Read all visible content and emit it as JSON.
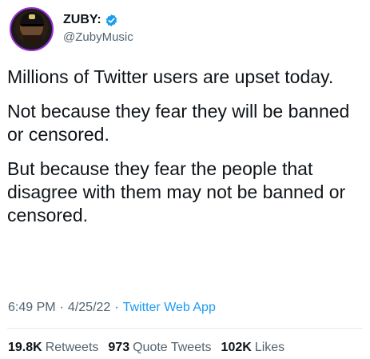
{
  "author": {
    "display_name": "ZUBY:",
    "handle": "@ZubyMusic",
    "verified": true,
    "avatar_border_color": "#9a2fd6"
  },
  "tweet": {
    "paragraphs": [
      "Millions of Twitter users are upset today.",
      "Not because they fear they will be banned or censored.",
      "But because they fear the people that disagree with them may not be banned or censored."
    ],
    "time": "6:49 PM",
    "date": "4/25/22",
    "separator": "·",
    "source": "Twitter Web App"
  },
  "stats": {
    "retweets_count": "19.8K",
    "retweets_label": "Retweets",
    "quotes_count": "973",
    "quotes_label": "Quote Tweets",
    "likes_count": "102K",
    "likes_label": "Likes"
  },
  "colors": {
    "verified_blue": "#1d9bf0",
    "muted_text": "#536471",
    "text": "#0f1419"
  }
}
